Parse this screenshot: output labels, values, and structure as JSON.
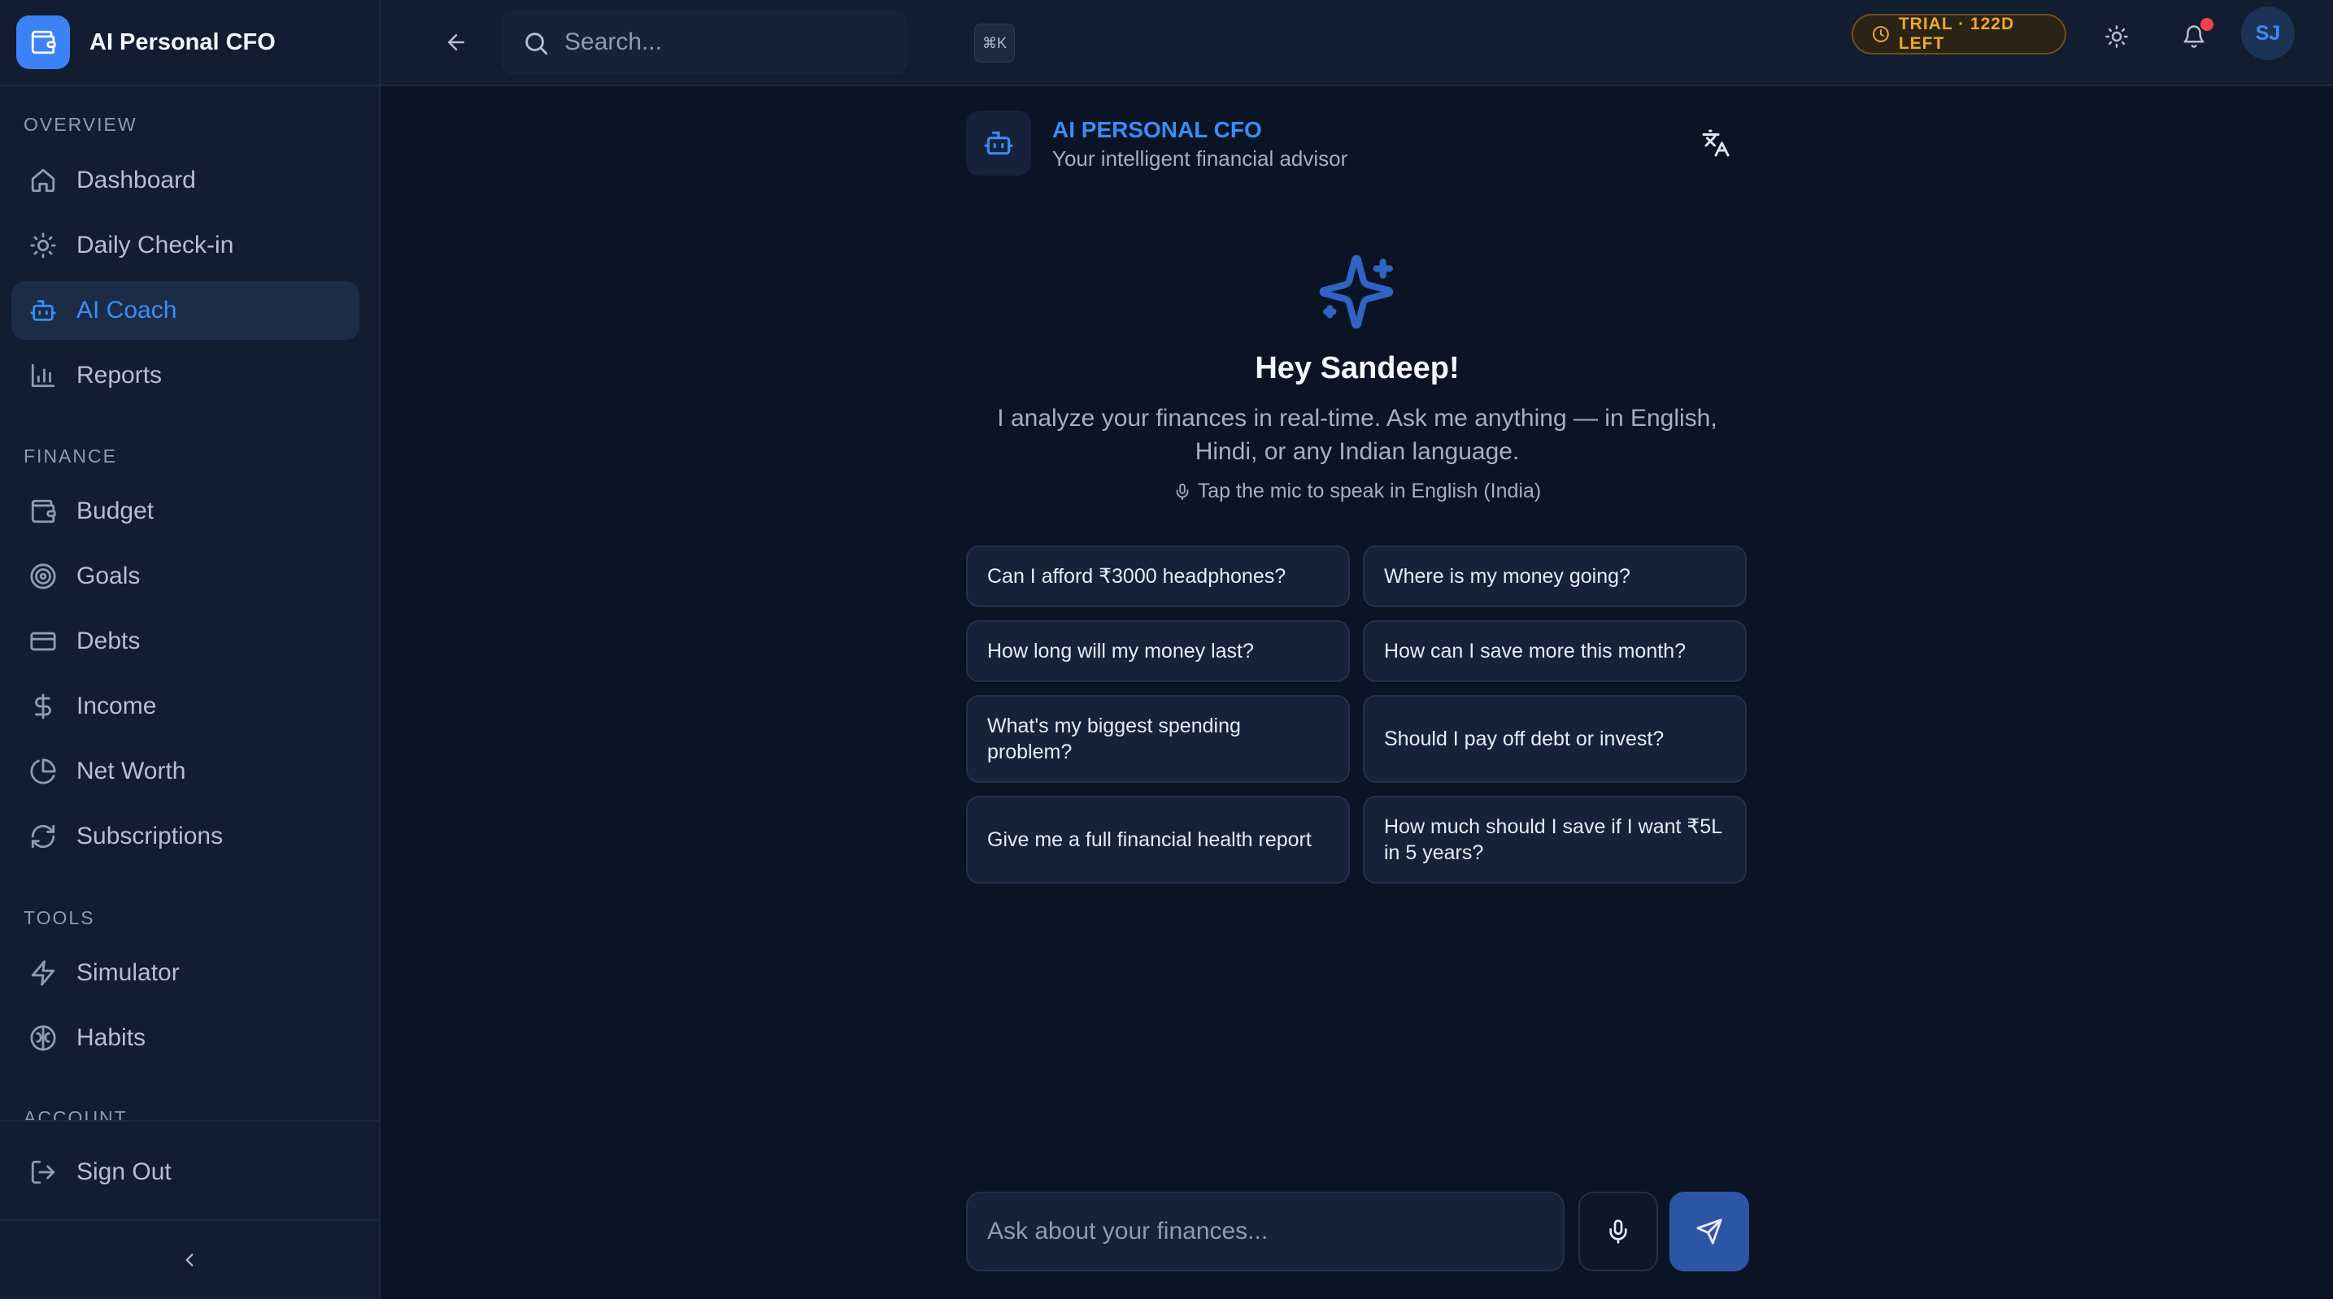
{
  "app": {
    "name": "AI Personal CFO"
  },
  "sidebar": {
    "sections": [
      {
        "label": "OVERVIEW"
      },
      {
        "label": "FINANCE"
      },
      {
        "label": "TOOLS"
      },
      {
        "label": "ACCOUNT"
      }
    ],
    "items": [
      {
        "label": "Dashboard",
        "icon": "home-icon"
      },
      {
        "label": "Daily Check-in",
        "icon": "sun-icon"
      },
      {
        "label": "AI Coach",
        "icon": "bot-icon",
        "active": true
      },
      {
        "label": "Reports",
        "icon": "bar-chart-icon"
      },
      {
        "label": "Budget",
        "icon": "wallet-icon"
      },
      {
        "label": "Goals",
        "icon": "target-icon"
      },
      {
        "label": "Debts",
        "icon": "credit-card-icon"
      },
      {
        "label": "Income",
        "icon": "dollar-icon"
      },
      {
        "label": "Net Worth",
        "icon": "pie-chart-icon"
      },
      {
        "label": "Subscriptions",
        "icon": "refresh-icon"
      },
      {
        "label": "Simulator",
        "icon": "zap-icon"
      },
      {
        "label": "Habits",
        "icon": "brain-icon"
      }
    ],
    "signout": {
      "label": "Sign Out",
      "icon": "logout-icon"
    }
  },
  "topbar": {
    "search": {
      "placeholder": "Search...",
      "shortcut": "⌘K"
    },
    "trial_badge": "TRIAL · 122D LEFT",
    "avatar_initials": "SJ"
  },
  "coach": {
    "title": "AI PERSONAL CFO",
    "subtitle": "Your intelligent financial advisor",
    "greeting": "Hey Sandeep!",
    "intro": "I analyze your finances in real-time. Ask me anything — in English, Hindi, or any Indian language.",
    "mic_hint": "Tap the mic to speak in English (India)",
    "suggestions": [
      "Can I afford ₹3000 headphones?",
      "Where is my money going?",
      "How long will my money last?",
      "How can I save more this month?",
      "What's my biggest spending problem?",
      "Should I pay off debt or invest?",
      "Give me a full financial health report",
      "How much should I save if I want ₹5L in 5 years?"
    ],
    "composer": {
      "placeholder": "Ask about your finances..."
    }
  },
  "colors": {
    "accent": "#3b8cf6",
    "background": "#0b1424",
    "sidebar": "#121d31",
    "trial": "#f3a629",
    "notification_dot": "#ef4444"
  }
}
